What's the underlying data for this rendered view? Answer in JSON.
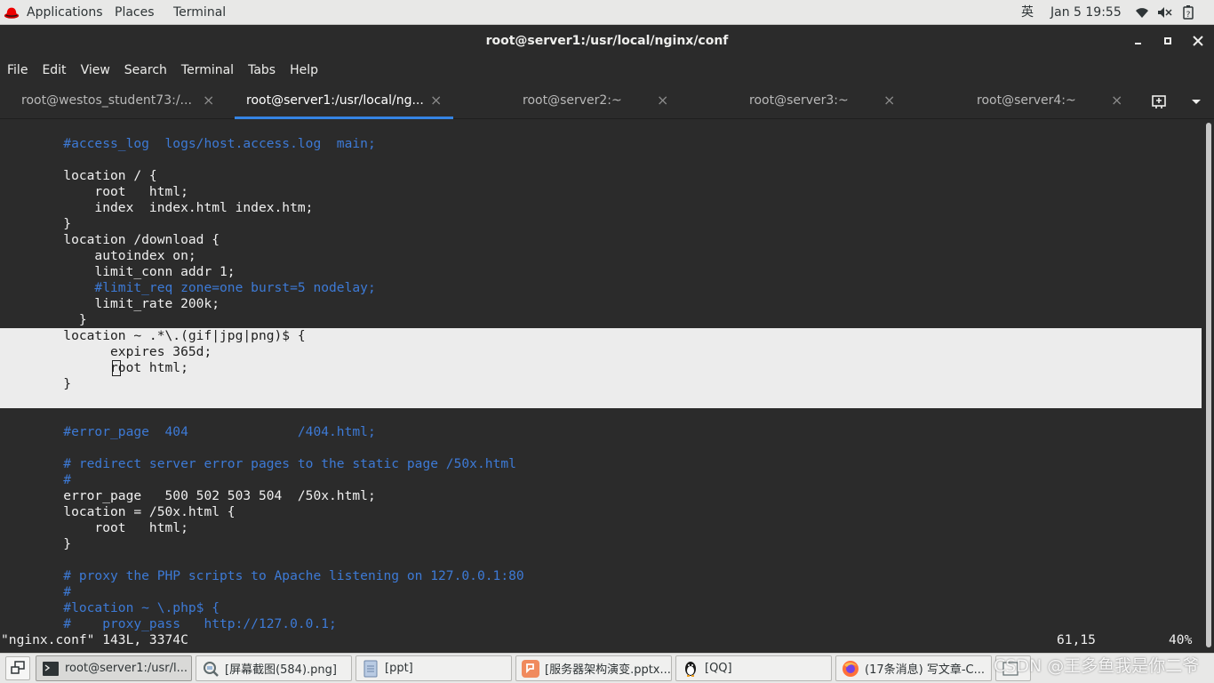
{
  "topbar": {
    "applications": "Applications",
    "places": "Places",
    "terminal": "Terminal",
    "input_method": "英",
    "clock": "Jan 5  19:55",
    "icons": [
      "redhat-icon",
      "wifi-icon",
      "volume-icon",
      "power-icon"
    ]
  },
  "window": {
    "title": "root@server1:/usr/local/nginx/conf",
    "controls": [
      "minimize-icon",
      "maximize-icon",
      "close-icon"
    ]
  },
  "menubar": [
    "File",
    "Edit",
    "View",
    "Search",
    "Terminal",
    "Tabs",
    "Help"
  ],
  "tabs": [
    {
      "label": "root@westos_student73:/...",
      "active": false
    },
    {
      "label": "root@server1:/usr/local/ng...",
      "active": true
    },
    {
      "label": "root@server2:~",
      "active": false
    },
    {
      "label": "root@server3:~",
      "active": false
    },
    {
      "label": "root@server4:~",
      "active": false
    }
  ],
  "tab_close_glyph": "×",
  "terminal": {
    "lines": [
      {
        "text": "        #access_log  logs/host.access.log  main;",
        "kind": "comment"
      },
      {
        "text": "",
        "kind": "normal"
      },
      {
        "text": "        location / {",
        "kind": "normal"
      },
      {
        "text": "            root   html;",
        "kind": "normal"
      },
      {
        "text": "            index  index.html index.htm;",
        "kind": "normal"
      },
      {
        "text": "        }",
        "kind": "normal"
      },
      {
        "text": "        location /download {",
        "kind": "normal"
      },
      {
        "text": "            autoindex on;",
        "kind": "normal"
      },
      {
        "text": "            limit_conn addr 1;",
        "kind": "normal"
      },
      {
        "text": "            #limit_req zone=one burst=5 nodelay;",
        "kind": "comment"
      },
      {
        "text": "            limit_rate 200k;",
        "kind": "normal"
      },
      {
        "text": "          }",
        "kind": "normal"
      },
      {
        "text": "        location ~ .*\\.(gif|jpg|png)$ {",
        "kind": "selected"
      },
      {
        "text": "              expires 365d;",
        "kind": "selected"
      },
      {
        "text": "              root html;",
        "kind": "selected"
      },
      {
        "text": "        }",
        "kind": "selected"
      },
      {
        "text": "",
        "kind": "selected"
      },
      {
        "text": "",
        "kind": "normal"
      },
      {
        "text": "        #error_page  404              /404.html;",
        "kind": "comment"
      },
      {
        "text": "",
        "kind": "normal"
      },
      {
        "text": "        # redirect server error pages to the static page /50x.html",
        "kind": "comment"
      },
      {
        "text": "        #",
        "kind": "comment"
      },
      {
        "text": "        error_page   500 502 503 504  /50x.html;",
        "kind": "normal"
      },
      {
        "text": "        location = /50x.html {",
        "kind": "normal"
      },
      {
        "text": "            root   html;",
        "kind": "normal"
      },
      {
        "text": "        }",
        "kind": "normal"
      },
      {
        "text": "",
        "kind": "normal"
      },
      {
        "text": "        # proxy the PHP scripts to Apache listening on 127.0.0.1:80",
        "kind": "comment"
      },
      {
        "text": "        #",
        "kind": "comment"
      },
      {
        "text": "        #location ~ \\.php$ {",
        "kind": "comment"
      },
      {
        "text": "        #    proxy_pass   http://127.0.0.1;",
        "kind": "comment"
      }
    ],
    "status_file": "\"nginx.conf\" 143L, 3374C",
    "status_position": "61,15",
    "status_percent": "40%"
  },
  "taskbar": {
    "items": [
      {
        "label": "root@server1:/usr/l...",
        "icon": "terminal-icon",
        "active": true
      },
      {
        "label": "[屏幕截图(584).png]",
        "icon": "image-viewer-icon",
        "active": false
      },
      {
        "label": "[ppt]",
        "icon": "file-manager-icon",
        "active": false
      },
      {
        "label": "[服务器架构演变.pptx...",
        "icon": "presentation-icon",
        "active": false
      },
      {
        "label": "[QQ]",
        "icon": "qq-penguin-icon",
        "active": false
      },
      {
        "label": "(17条消息) 写文章-C...",
        "icon": "firefox-icon",
        "active": false
      },
      {
        "label": "",
        "icon": "window-icon",
        "active": false
      }
    ],
    "watermark": "CSDN @王多鱼我是你二爷"
  },
  "colors": {
    "terminal_bg": "#2b2b2b",
    "terminal_fg": "#f0f0f0",
    "comment": "#3d7ad6",
    "selection_bg": "#ececec",
    "accent": "#3584e4",
    "redhat": "#ee0000"
  }
}
